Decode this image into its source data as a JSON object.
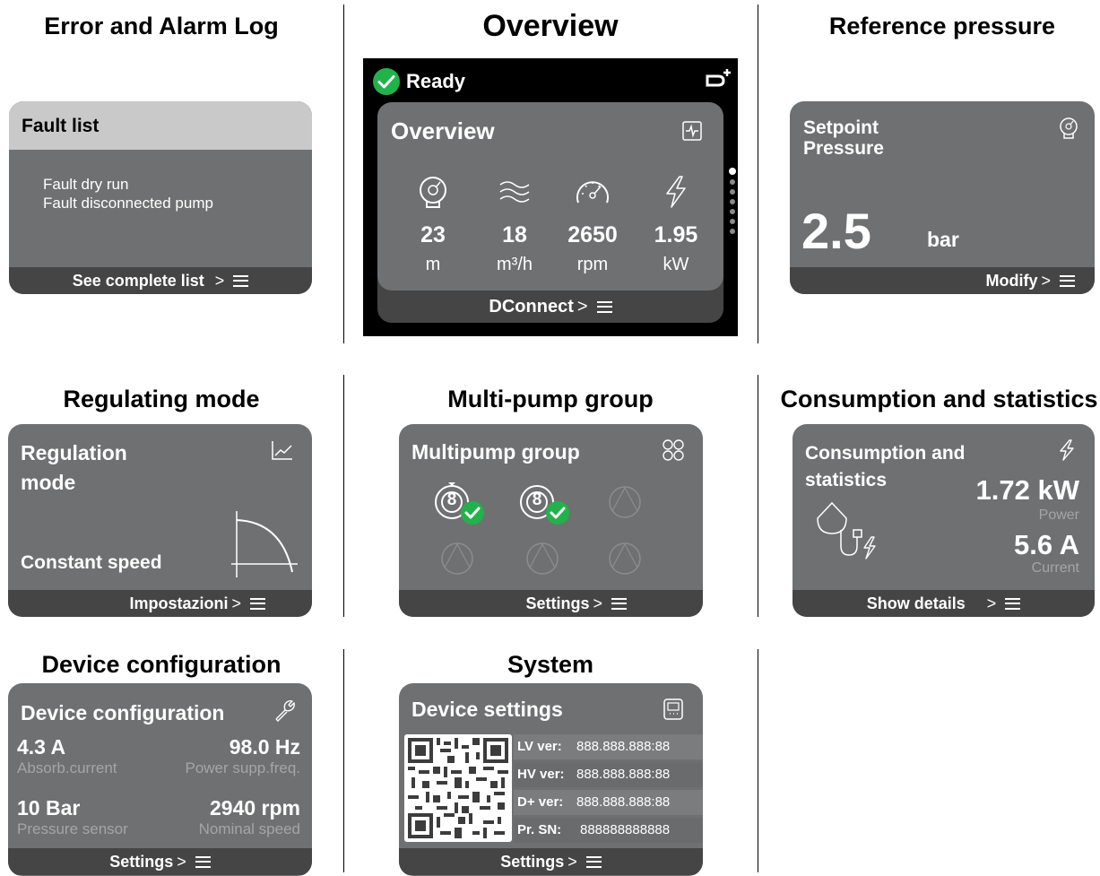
{
  "sections": {
    "error_log": "Error and Alarm Log",
    "overview": "Overview",
    "reference_pressure": "Reference pressure",
    "regulating_mode": "Regulating mode",
    "multi_pump": "Multi-pump group",
    "consumption": "Consumption and statistics",
    "device_config": "Device configuration",
    "system": "System"
  },
  "fault_card": {
    "header": "Fault list",
    "items": [
      "Fault dry run",
      "Fault disconnected pump"
    ],
    "footer": "See complete list"
  },
  "overview_screen": {
    "status": "Ready",
    "title": "Overview",
    "metrics": [
      {
        "icon": "pressure-gauge-icon",
        "value": "23",
        "unit": "m"
      },
      {
        "icon": "flow-waves-icon",
        "value": "18",
        "unit": "m³/h"
      },
      {
        "icon": "speedometer-icon",
        "value": "2650",
        "unit": "rpm"
      },
      {
        "icon": "lightning-icon",
        "value": "1.95",
        "unit": "kW"
      }
    ],
    "footer": "DConnect",
    "page_dots": 7,
    "active_dot": 1
  },
  "setpoint_card": {
    "title_line1": "Setpoint",
    "title_line2": "Pressure",
    "value": "2.5",
    "unit": "bar",
    "footer": "Modify"
  },
  "regulation_card": {
    "title_line1": "Regulation",
    "title_line2": "mode",
    "mode": "Constant speed",
    "footer": "Impostazioni"
  },
  "multipump_card": {
    "title": "Multipump group",
    "pump_number": "8",
    "footer": "Settings"
  },
  "consumption_card": {
    "title_line1": "Consumption and",
    "title_line2": "statistics",
    "power_value": "1.72 kW",
    "power_label": "Power",
    "current_value": "5.6 A",
    "current_label": "Current",
    "footer": "Show details"
  },
  "device_config_card": {
    "title": "Device configuration",
    "absorb_value": "4.3 A",
    "absorb_label": "Absorb.current",
    "freq_value": "98.0 Hz",
    "freq_label": "Power supp.freq.",
    "pressure_value": "10 Bar",
    "pressure_label": "Pressure sensor",
    "speed_value": "2940 rpm",
    "speed_label": "Nominal speed",
    "footer": "Settings"
  },
  "device_settings_card": {
    "title": "Device settings",
    "rows": [
      {
        "label": "LV ver:",
        "value": "888.888.888:88"
      },
      {
        "label": "HV ver:",
        "value": "888.888.888:88"
      },
      {
        "label": "D+ ver:",
        "value": "888.888.888:88"
      },
      {
        "label": "Pr. SN:",
        "value": "888888888888"
      }
    ],
    "footer": "Settings"
  },
  "colors": {
    "card": "#6f7071",
    "footer": "#454546",
    "fault_header": "#c9c9c9",
    "check_green": "#22b24c",
    "screen_bg": "#000000"
  }
}
